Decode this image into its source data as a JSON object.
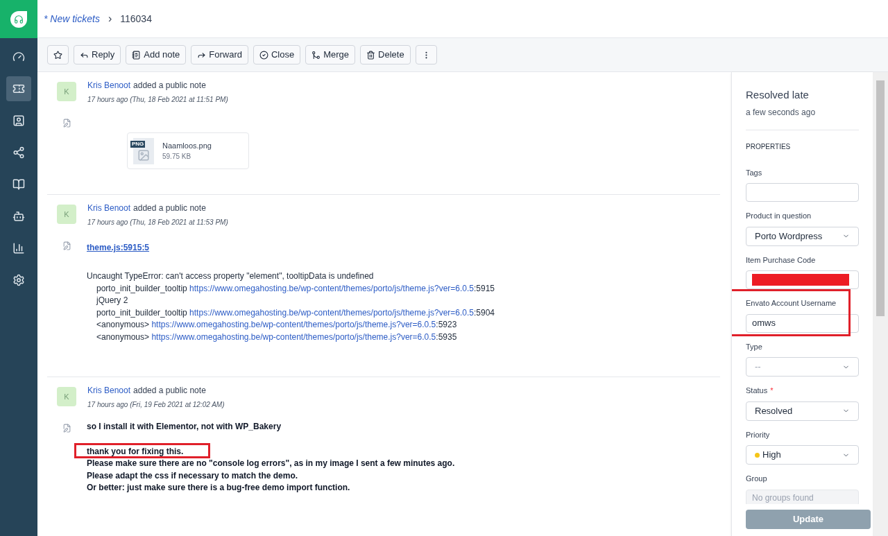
{
  "sidebar": {
    "items": [
      {
        "selected": false
      },
      {
        "selected": true
      },
      {
        "selected": false
      },
      {
        "selected": false
      },
      {
        "selected": false
      },
      {
        "selected": false
      },
      {
        "selected": false
      },
      {
        "selected": false
      }
    ]
  },
  "breadcrumb": {
    "parent": "* New tickets",
    "separator": "›",
    "current": "116034"
  },
  "toolbar": {
    "buttons": [
      "Reply",
      "Add note",
      "Forward",
      "Close",
      "Merge",
      "Delete"
    ]
  },
  "notes": [
    {
      "avatar": "K",
      "author": "Kris Benoot",
      "action": "added a public note",
      "time": "17 hours ago (Thu, 18 Feb 2021 at 11:51 PM)",
      "body": [
        {
          "kind": "attachment",
          "name": "Naamloos.png",
          "size": "59.75 KB",
          "badge": "PNG"
        }
      ]
    },
    {
      "avatar": "K",
      "author": "Kris Benoot",
      "action": "added a public note",
      "time": "17 hours ago (Thu, 18 Feb 2021 at 11:53 PM)",
      "body": [
        {
          "kind": "heading-link",
          "text": "theme.js:5915:5"
        },
        {
          "kind": "error",
          "message": "Uncaught TypeError: can't access property \"element\", tooltipData is undefined",
          "frames": [
            {
              "function": "porto_init_builder_tooltip",
              "url": "https://www.omegahosting.be/wp-content/themes/porto/js/theme.js?ver=6.0.5",
              "line": ":5915"
            },
            {
              "function": "jQuery 2"
            },
            {
              "function": "porto_init_builder_tooltip",
              "url": "https://www.omegahosting.be/wp-content/themes/porto/js/theme.js?ver=6.0.5",
              "line": ":5904"
            },
            {
              "function": "<anonymous>",
              "url": "https://www.omegahosting.be/wp-content/themes/porto/js/theme.js?ver=6.0.5",
              "line": ":5923"
            },
            {
              "function": "<anonymous>",
              "url": "https://www.omegahosting.be/wp-content/themes/porto/js/theme.js?ver=6.0.5",
              "line": ":5935"
            }
          ]
        }
      ]
    },
    {
      "avatar": "K",
      "author": "Kris Benoot",
      "action": "added a public note",
      "time": "17 hours ago (Fri, 19 Feb 2021 at 12:02 AM)",
      "body": [
        {
          "kind": "bold-text",
          "lines": [
            {
              "text": "so I install it with Elementor, not with WP_Bakery"
            }
          ]
        },
        {
          "kind": "bold-text",
          "lines": [
            {
              "text": "thank you for fixing this.",
              "highlighted": true
            },
            {
              "text": "Please make sure there are no \"console log errors\", as in my image I sent a few minutes ago."
            },
            {
              "text": "Please adapt the css if necessary to match the demo."
            },
            {
              "text": "Or better: just make sure there is a bug-free demo import function."
            }
          ]
        }
      ]
    }
  ],
  "panel": {
    "status_title": "Resolved late",
    "status_time": "a few seconds ago",
    "section": "PROPERTIES",
    "fields": [
      {
        "kind": "input",
        "label": "Tags"
      },
      {
        "kind": "select",
        "label": "Product in question",
        "value": "Porto Wordpress"
      },
      {
        "kind": "input",
        "label": "Item Purchase Code",
        "redacted": true
      },
      {
        "kind": "input",
        "label": "Envato Account Username",
        "value": "omws",
        "highlighted": true
      },
      {
        "kind": "select",
        "label": "Type",
        "placeholder": "--"
      },
      {
        "kind": "select",
        "label": "Status",
        "value": "Resolved",
        "required_mark": "*"
      },
      {
        "kind": "select",
        "label": "Priority",
        "value": "High",
        "color": "#f5c518"
      },
      {
        "kind": "disabled",
        "label": "Group",
        "placeholder": "No groups found"
      }
    ],
    "update_button": "Update"
  }
}
